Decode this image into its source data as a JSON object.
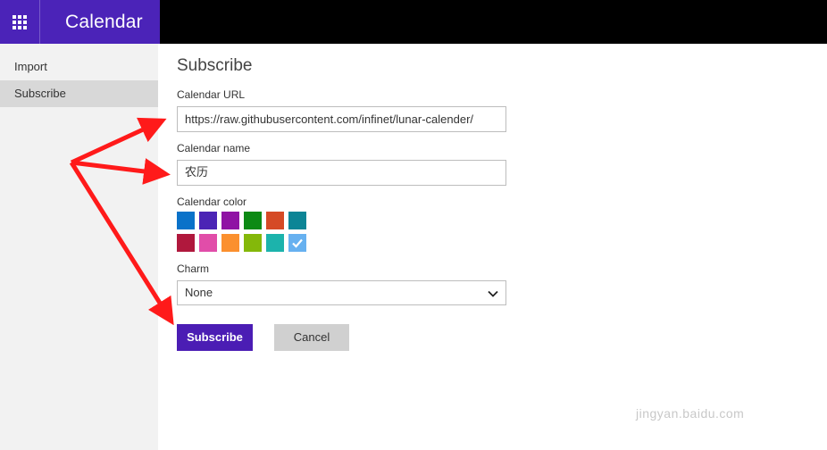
{
  "app": {
    "title": "Calendar"
  },
  "sidebar": {
    "items": [
      {
        "label": "Import"
      },
      {
        "label": "Subscribe"
      }
    ]
  },
  "form": {
    "title": "Subscribe",
    "url_label": "Calendar URL",
    "url_value": "https://raw.githubusercontent.com/infinet/lunar-calender/",
    "name_label": "Calendar name",
    "name_value": "农历",
    "color_label": "Calendar color",
    "colors": [
      "#0a72c9",
      "#4b24b5",
      "#8f12a4",
      "#0d8a14",
      "#d54a25",
      "#0c8596",
      "#b0183d",
      "#e14da9",
      "#fb902e",
      "#84b80a",
      "#1cb3ac",
      "#67b1f0"
    ],
    "selected_color": "#67b1f0",
    "charm_label": "Charm",
    "charm_value": "None",
    "subscribe_label": "Subscribe",
    "cancel_label": "Cancel"
  },
  "watermark": {
    "text": "jingyan.baidu.com"
  }
}
